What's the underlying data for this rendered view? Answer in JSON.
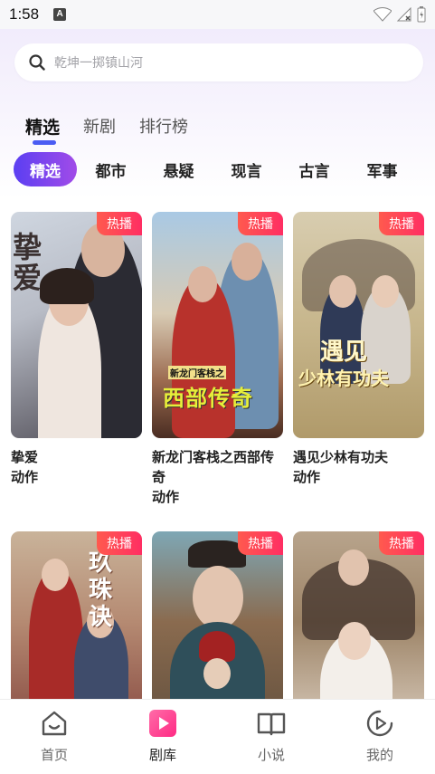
{
  "status_bar": {
    "time": "1:58",
    "a_indicator": "A"
  },
  "search": {
    "placeholder": "乾坤一掷镇山河"
  },
  "main_tabs": [
    {
      "label": "精选",
      "active": true
    },
    {
      "label": "新剧",
      "active": false
    },
    {
      "label": "排行榜",
      "active": false
    }
  ],
  "categories": [
    {
      "label": "精选",
      "active": true
    },
    {
      "label": "都市",
      "active": false
    },
    {
      "label": "悬疑",
      "active": false
    },
    {
      "label": "现言",
      "active": false
    },
    {
      "label": "古言",
      "active": false
    },
    {
      "label": "军事",
      "active": false
    }
  ],
  "cards": [
    {
      "title": "挚爱",
      "tag": "动作",
      "badge": "热播",
      "poster_text": "挚爱"
    },
    {
      "title": "新龙门客栈之西部传奇",
      "tag": "动作",
      "badge": "热播",
      "poster_text": "西部传奇",
      "poster_subtext": "新龙门客栈之"
    },
    {
      "title": "遇见少林有功夫",
      "tag": "动作",
      "badge": "热播",
      "poster_text": "遇见",
      "poster_subtext": "少林有功夫"
    },
    {
      "title": "",
      "tag": "",
      "badge": "热播",
      "poster_text": "玖珠诀"
    },
    {
      "title": "",
      "tag": "",
      "badge": "热播",
      "poster_text": ""
    },
    {
      "title": "",
      "tag": "",
      "badge": "热播",
      "poster_text": ""
    }
  ],
  "bottom_nav": [
    {
      "label": "首页",
      "icon": "home-icon",
      "active": false
    },
    {
      "label": "剧库",
      "icon": "play-library-icon",
      "active": true
    },
    {
      "label": "小说",
      "icon": "book-icon",
      "active": false
    },
    {
      "label": "我的",
      "icon": "profile-play-icon",
      "active": false
    }
  ],
  "colors": {
    "accent_start": "#5b3ff2",
    "accent_end": "#a14be8",
    "tab_indicator": "#4a5cf3",
    "hot_badge": "#ff3b5c",
    "library_icon_start": "#ff5fa2",
    "library_icon_end": "#ff2e88"
  }
}
